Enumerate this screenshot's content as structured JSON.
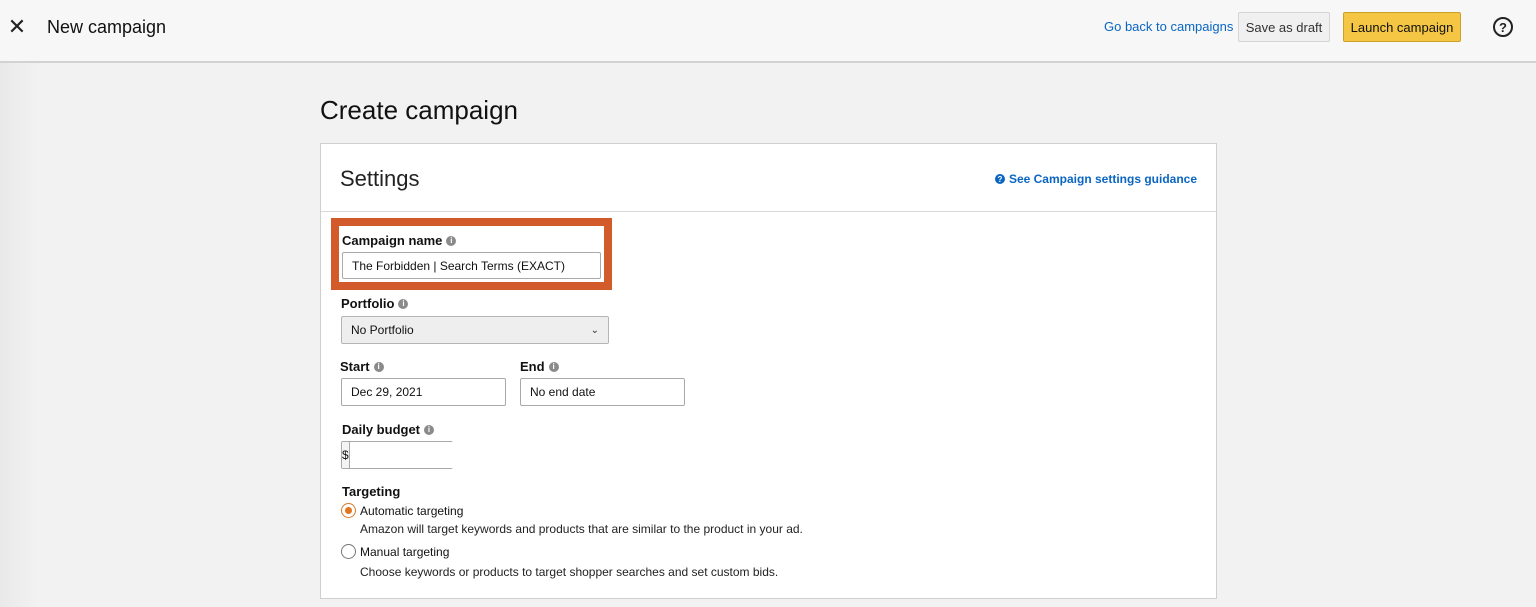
{
  "header": {
    "close_icon": "close-icon",
    "title": "New campaign",
    "back_link": "Go back to campaigns",
    "save_draft": "Save as draft",
    "launch": "Launch campaign",
    "help_icon": "help-circle-icon"
  },
  "page": {
    "title": "Create campaign"
  },
  "settings": {
    "title": "Settings",
    "guidance_link": "See Campaign settings guidance",
    "campaign_name": {
      "label": "Campaign name",
      "value": "The Forbidden | Search Terms (EXACT)"
    },
    "portfolio": {
      "label": "Portfolio",
      "selected": "No Portfolio"
    },
    "start": {
      "label": "Start",
      "value": "Dec 29, 2021"
    },
    "end": {
      "label": "End",
      "value": "No end date"
    },
    "daily_budget": {
      "label": "Daily budget",
      "currency": "$",
      "value": ""
    },
    "targeting": {
      "label": "Targeting",
      "options": [
        {
          "label": "Automatic targeting",
          "description": "Amazon will target keywords and products that are similar to the product in your ad.",
          "selected": true
        },
        {
          "label": "Manual targeting",
          "description": "Choose keywords or products to target shopper searches and set custom bids.",
          "selected": false
        }
      ]
    }
  },
  "colors": {
    "accent_orange": "#d35a2a",
    "launch_yellow": "#f5c644",
    "link_blue": "#0a66c2"
  }
}
